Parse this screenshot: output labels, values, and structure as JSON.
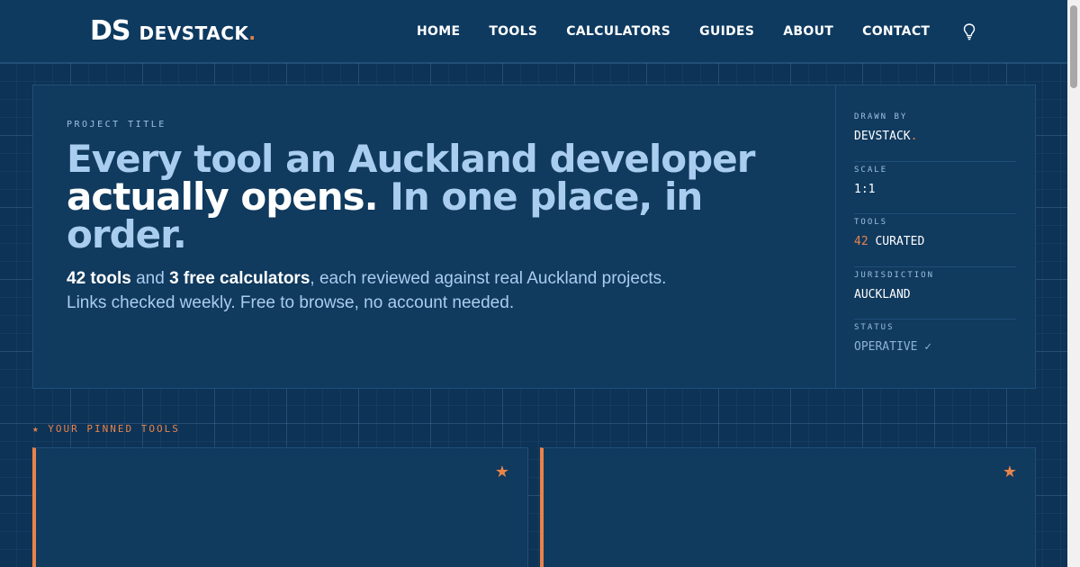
{
  "header": {
    "logo_mark": "DS",
    "logo_name": "DEVSTACK",
    "logo_dot": ".",
    "nav": [
      "HOME",
      "TOOLS",
      "CALCULATORS",
      "GUIDES",
      "ABOUT",
      "CONTACT"
    ],
    "theme_icon": "lightbulb-icon"
  },
  "hero": {
    "eyebrow": "PROJECT TITLE",
    "headline_part1": "Every tool an Auckland developer ",
    "headline_bold": "actually opens.",
    "headline_part2": " In one place, in order.",
    "lede_bold1": "42 tools",
    "lede_text1": " and ",
    "lede_bold2": "3 free calculators",
    "lede_text2": ", each reviewed against real Auckland projects. Links checked weekly. Free to browse, no account needed."
  },
  "spec": {
    "drawn_by_label": "DRAWN BY",
    "drawn_by_value": "DEVSTACK",
    "drawn_by_dot": ".",
    "scale_label": "SCALE",
    "scale_value": "1:1",
    "tools_label": "TOOLS",
    "tools_count": "42",
    "tools_value": "CURATED",
    "jurisdiction_label": "JURISDICTION",
    "jurisdiction_value": "AUCKLAND",
    "status_label": "STATUS",
    "status_value": "OPERATIVE ✓"
  },
  "pinned": {
    "label": "★ YOUR PINNED TOOLS",
    "star": "★"
  },
  "colors": {
    "background": "#0d3356",
    "panel": "#103a5e",
    "accent": "#e8834a",
    "text_light": "#a9cdee"
  }
}
